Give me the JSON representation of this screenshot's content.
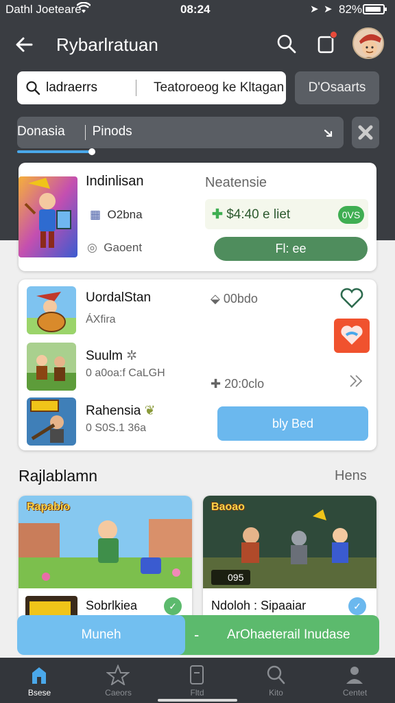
{
  "status_bar": {
    "carrier": "Dathl Joeteare",
    "time": "08:24",
    "battery": "82%"
  },
  "header": {
    "title": "Rybarlratuan"
  },
  "search": {
    "value_left": "ladraerrs",
    "value_right": "Teatoroeog ke Kltagan",
    "action": "D'Osaarts"
  },
  "filter": {
    "left": "Donasia",
    "right": "Pinods"
  },
  "featured": {
    "name": "Indinlisan",
    "status": "Neatensie",
    "meta1": "O2bna",
    "meta2": "Gaoent",
    "price": "$4:40 e liet",
    "badge": "0VS",
    "buy_label": "Fl: ee"
  },
  "list": [
    {
      "title": "UordalStan",
      "sub": "ÁXfira",
      "extra": "00bdo"
    },
    {
      "title": "Suulm",
      "sub": "0 a0oa:f CaLGH",
      "extra": "20:0clo"
    },
    {
      "title": "Rahensia",
      "sub": "0 S0S.1 36a"
    }
  ],
  "list_action": "bly Bed",
  "section": {
    "title": "Rajlablamn",
    "more": "Hens"
  },
  "tiles": [
    {
      "art_label": "Rapabio",
      "name": "Sobrlkiea"
    },
    {
      "art_label": "Baoao",
      "price": "095",
      "name": "Ndoloh : Sipaaiar"
    }
  ],
  "bottom_actions": {
    "left": "Muneh",
    "dash": "-",
    "right": "ArOhaeterail Inudase"
  },
  "tabs": [
    {
      "label": "Bsese"
    },
    {
      "label": "Caeors"
    },
    {
      "label": "Fltd"
    },
    {
      "label": "Kito"
    },
    {
      "label": "Centet"
    }
  ],
  "colors": {
    "dark_bg": "#3a3d42",
    "green": "#4f8d5d",
    "blue": "#6bb8ee",
    "bright_green": "#5cba6d"
  }
}
